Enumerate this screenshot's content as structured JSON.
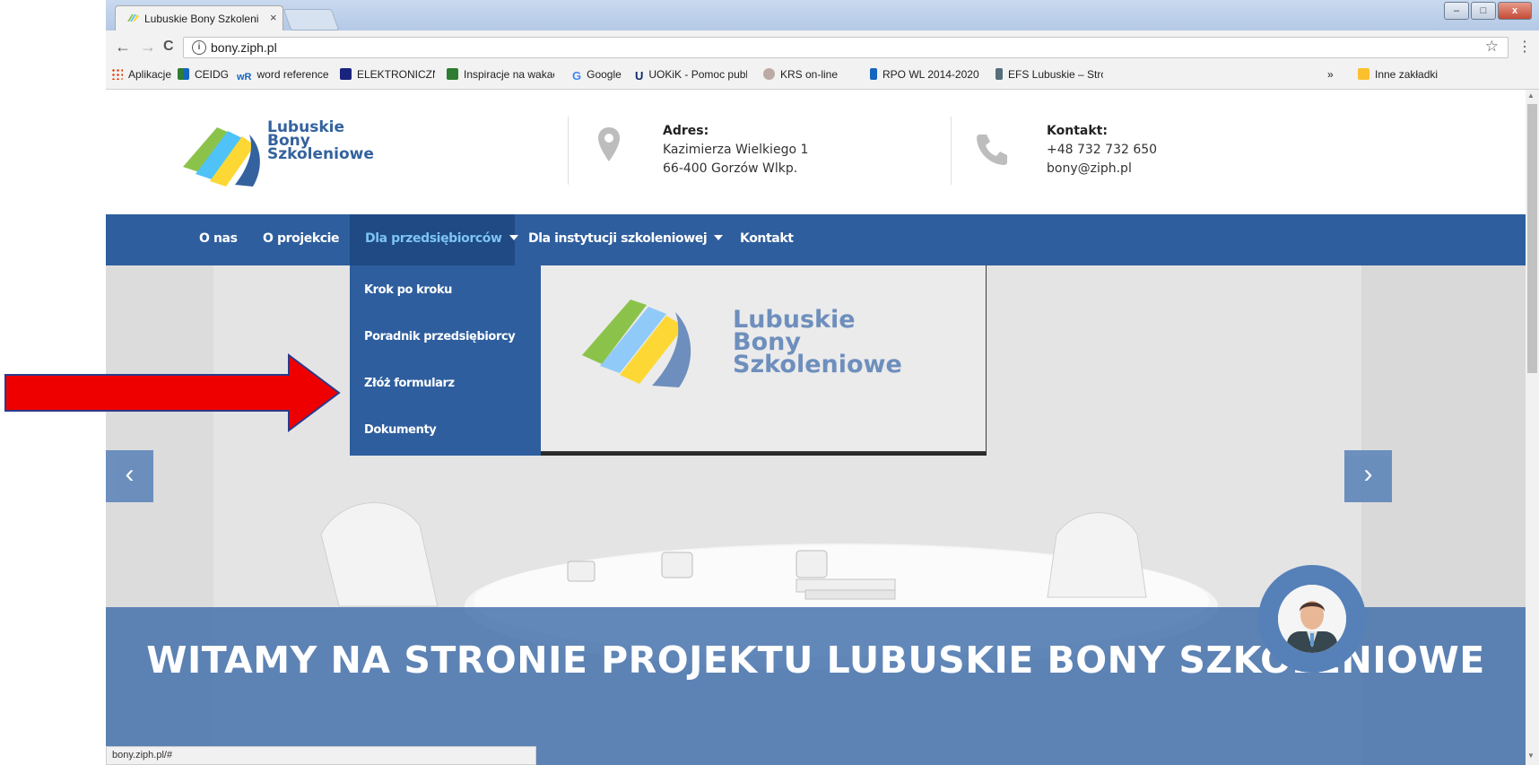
{
  "browser": {
    "tab_title": "Lubuskie Bony Szkolenio",
    "tab_close": "×",
    "url": "bony.ziph.pl",
    "info_glyph": "i",
    "star_glyph": "☆",
    "menu_glyph": "⋮",
    "back_glyph": "←",
    "forward_glyph": "→",
    "reload_glyph": "C",
    "window_minimize": "–",
    "window_maximize": "□",
    "window_close": "x",
    "status_url": "bony.ziph.pl/#",
    "bookmarks": [
      {
        "label": "Aplikacje",
        "color": "#e64a19"
      },
      {
        "label": "CEIDG",
        "color": "#2e7d32"
      },
      {
        "label": "word reference",
        "color": "#1565c0"
      },
      {
        "label": "ELEKTRONICZNE KSI",
        "color": "#1a237e"
      },
      {
        "label": "Inspiracje na wakacje",
        "color": "#2e7d32"
      },
      {
        "label": "Google",
        "color": "#4285f4"
      },
      {
        "label": "UOKiK - Pomoc publ",
        "color": "#0d2a6b"
      },
      {
        "label": "KRS on-line",
        "color": "#8d6e63"
      },
      {
        "label": "RPO WL 2014-2020",
        "color": "#1565c0"
      },
      {
        "label": "EFS Lubuskie – Stron",
        "color": "#546e7a"
      }
    ],
    "bookmarks_more": "»",
    "other_bookmarks": "Inne zakładki"
  },
  "header": {
    "logo_line1": "Lubuskie",
    "logo_line2": "Bony",
    "logo_line3": "Szkoleniowe",
    "address_heading": "Adres:",
    "address_line1": "Kazimierza Wielkiego 1",
    "address_line2": "66-400 Gorzów Wlkp.",
    "contact_heading": "Kontakt:",
    "contact_phone": "+48 732 732 650",
    "contact_email": "bony@ziph.pl"
  },
  "nav": {
    "items": [
      {
        "label": "O nas"
      },
      {
        "label": "O projekcie"
      },
      {
        "label": "Dla przedsiębiorców"
      },
      {
        "label": "Dla instytucji szkoleniowej"
      },
      {
        "label": "Kontakt"
      }
    ],
    "dropdown": [
      {
        "label": "Krok po kroku"
      },
      {
        "label": "Poradnik przedsiębiorcy"
      },
      {
        "label": "Złóż formularz"
      },
      {
        "label": "Dokumenty"
      }
    ]
  },
  "hero": {
    "screen_logo_line1": "Lubuskie",
    "screen_logo_line2": "Bony",
    "screen_logo_line3": "Szkoleniowe",
    "prev_glyph": "‹",
    "next_glyph": "›",
    "banner_text": "WITAMY NA STRONIE PROJEKTU LUBUSKIE BONY SZKOLENIOWE"
  },
  "colors": {
    "brand_blue": "#2e5e9e",
    "annotation_arrow": "#ee0000"
  }
}
